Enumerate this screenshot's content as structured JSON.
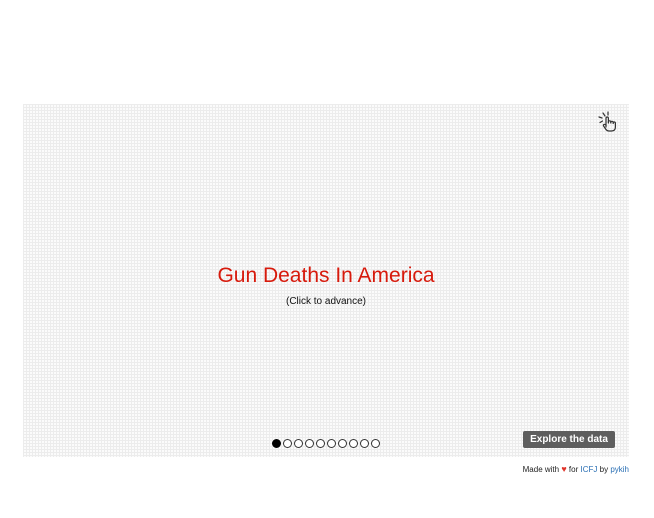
{
  "slideshow": {
    "title": "Gun Deaths In America",
    "subtitle": "(Click to advance)",
    "slide_count": 10,
    "current_slide": 1,
    "explore_button": "Explore the data",
    "click_icon": "hand-tap-icon",
    "colors": {
      "title": "#d71a0c",
      "button_bg": "#5e5e5e"
    }
  },
  "footer": {
    "made_with": "Made with",
    "heart": "♥",
    "for_text": "for",
    "icfj_link": "ICFJ",
    "by_text": "by",
    "pykih_link": "pykih"
  }
}
